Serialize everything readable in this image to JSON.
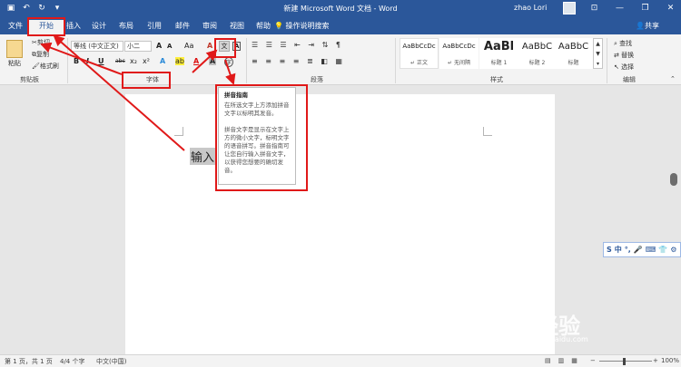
{
  "titlebar": {
    "title": "新建 Microsoft Word 文档 - Word",
    "user": "zhao Lori",
    "qat_icons": [
      "save-icon",
      "undo-icon",
      "redo-icon",
      "customize-icon"
    ],
    "window_controls": [
      "ribbon-display-icon",
      "minimize-icon",
      "restore-icon",
      "close-icon"
    ]
  },
  "tabs": [
    "文件",
    "开始",
    "插入",
    "设计",
    "布局",
    "引用",
    "邮件",
    "审阅",
    "视图",
    "帮助"
  ],
  "active_tab": "开始",
  "tell_me": "操作说明搜索",
  "share": "共享",
  "ribbon": {
    "clipboard": {
      "paste": "粘贴",
      "cut": "剪切",
      "copy": "复制",
      "format_painter": "格式刷",
      "label": "剪贴板"
    },
    "font": {
      "font_name": "等线 (中文正文)",
      "font_size": "小二",
      "grow": "A",
      "shrink": "A",
      "change_case": "Aa",
      "clear_format": "A",
      "phonetic": "文",
      "char_border": "A",
      "bold": "B",
      "italic": "I",
      "underline": "U",
      "strike": "abc",
      "subscript": "x₂",
      "superscript": "x²",
      "text_effects": "A",
      "highlight": "ab",
      "font_color": "A",
      "char_shading": "A",
      "enclose": "字",
      "label": "字体"
    },
    "paragraph": {
      "label": "段落"
    },
    "styles": {
      "items": [
        {
          "sample": "AaBbCcDc",
          "name": "↵ 正文"
        },
        {
          "sample": "AaBbCcDc",
          "name": "↵ 无间隔"
        },
        {
          "sample": "AaBl",
          "name": "标题 1"
        },
        {
          "sample": "AaBbC",
          "name": "标题 2"
        },
        {
          "sample": "AaBbC",
          "name": "标题"
        }
      ],
      "label": "样式"
    },
    "editing": {
      "find": "查找",
      "replace": "替换",
      "select": "选择",
      "label": "编辑"
    }
  },
  "tooltip": {
    "title": "拼音指南",
    "para1": "在所选文字上方添加拼音文字以标明其发音。",
    "para2": "拼音文字是显示在文字上方的微小文字，标明文字的语音拼写。拼音指南可让您自行输入拼音文字，以获得您想要的确切发音。"
  },
  "document": {
    "text": "输入"
  },
  "floatbar": {
    "items": [
      "S",
      "中",
      "°,",
      "🎤",
      "⌨",
      "👕",
      "⚙"
    ]
  },
  "watermark": {
    "text": "Bai 经验",
    "sub": "jingyan.baidu.com"
  },
  "status": {
    "page": "第 1 页，共 1 页",
    "words": "4/4 个字",
    "lang": "中文(中国)",
    "zoom": "100%"
  },
  "colors": {
    "accent": "#2b579a",
    "annotation": "#e01919"
  }
}
